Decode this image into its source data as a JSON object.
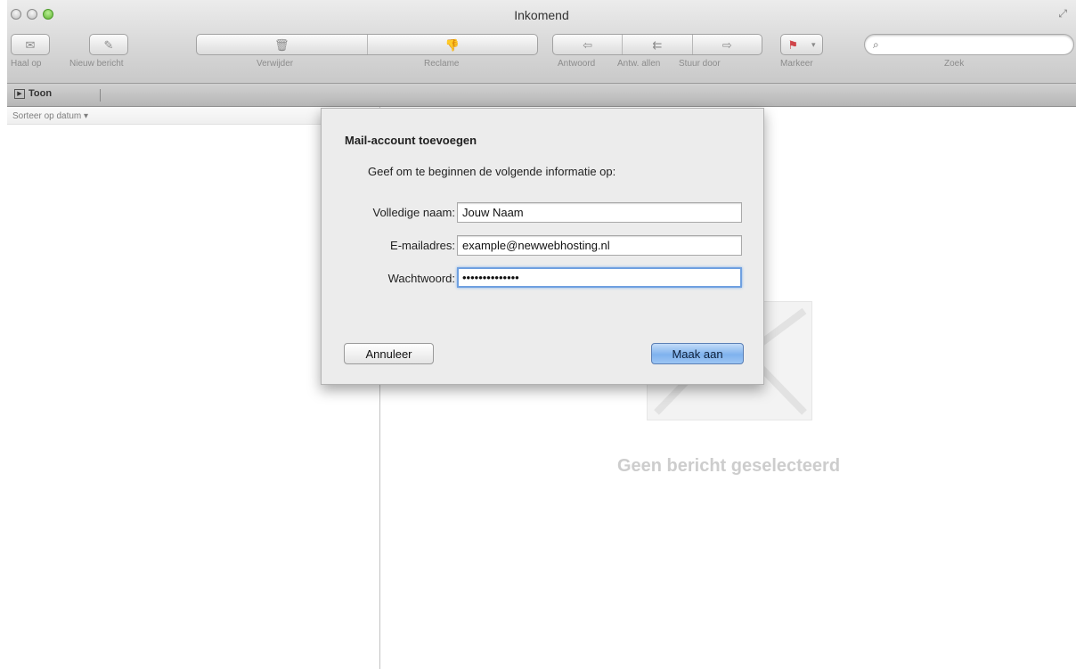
{
  "window": {
    "title": "Inkomend"
  },
  "toolbar": {
    "get_mail": "Haal op",
    "new_message": "Nieuw bericht",
    "delete": "Verwijder",
    "junk": "Reclame",
    "reply": "Antwoord",
    "reply_all": "Antw. allen",
    "forward": "Stuur door",
    "flag": "Markeer",
    "search": "Zoek"
  },
  "subbar": {
    "show_label": "Toon"
  },
  "list": {
    "sort_label": "Sorteer op datum ▾"
  },
  "viewer": {
    "empty_text": "Geen bericht geselecteerd"
  },
  "dialog": {
    "title": "Mail-account toevoegen",
    "intro": "Geef om te beginnen de volgende informatie op:",
    "name_label": "Volledige naam:",
    "name_value": "Jouw Naam",
    "email_label": "E-mailadres:",
    "email_value": "example@newwebhosting.nl",
    "password_label": "Wachtwoord:",
    "password_value": "••••••••••••••",
    "cancel_label": "Annuleer",
    "create_label": "Maak aan"
  },
  "colors": {
    "accent": "#7fb2ee",
    "focus_ring": "#6fa0e0"
  }
}
